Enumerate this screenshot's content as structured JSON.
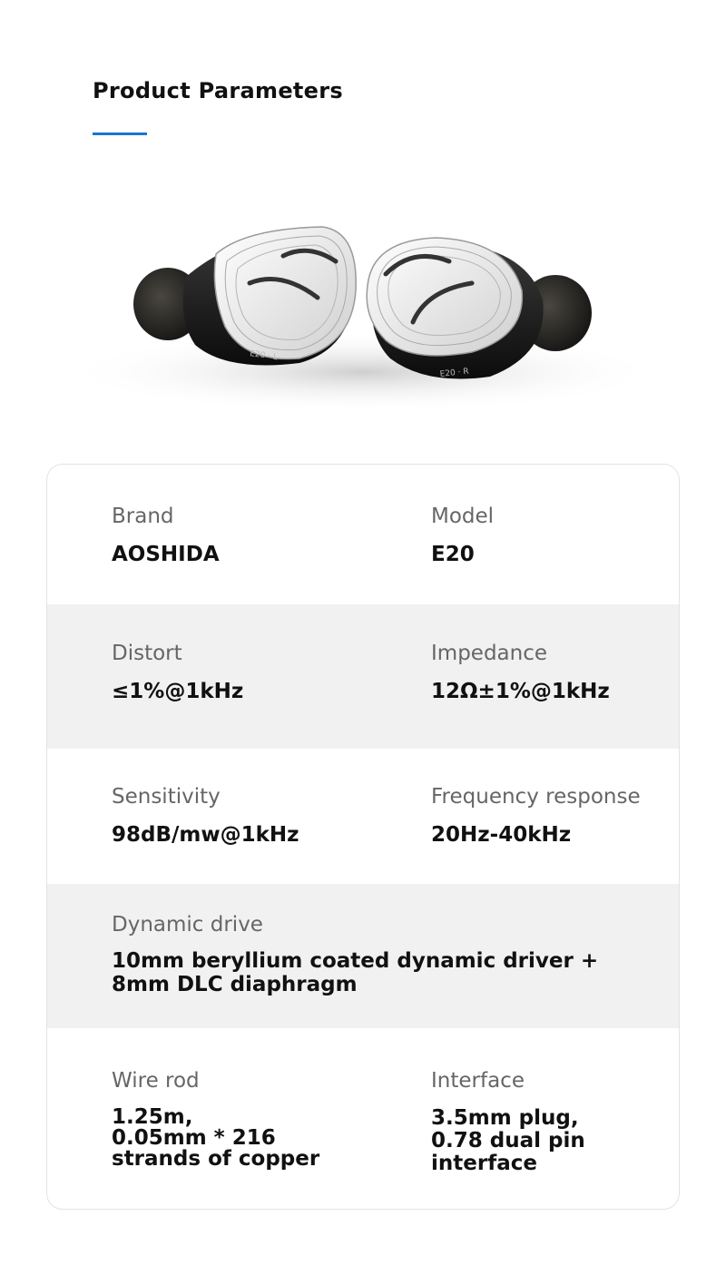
{
  "heading": {
    "title": "Product Parameters"
  },
  "product": {
    "left_mark": "E20 · L",
    "right_mark": "E20 · R"
  },
  "params": {
    "brand": {
      "label": "Brand",
      "value": "AOSHIDA"
    },
    "model": {
      "label": "Model",
      "value": "E20"
    },
    "distort": {
      "label": "Distort",
      "value": "≤1%@1kHz"
    },
    "impedance": {
      "label": "Impedance",
      "value": "12Ω±1%@1kHz"
    },
    "sensitivity": {
      "label": "Sensitivity",
      "value": "98dB/mw@1kHz"
    },
    "frequency": {
      "label": "Frequency response",
      "value": "20Hz-40kHz"
    },
    "dynamic": {
      "label": "Dynamic drive",
      "value": "10mm beryllium coated dynamic driver +\n8mm DLC diaphragm"
    },
    "wire": {
      "label": "Wire rod",
      "value": "1.25m,\n0.05mm * 216\nstrands of copper"
    },
    "interface": {
      "label": "Interface",
      "value": "3.5mm plug,\n0.78 dual pin\ninterface"
    }
  },
  "colors": {
    "accent": "#1677d2",
    "shade": "#f1f1f1"
  }
}
